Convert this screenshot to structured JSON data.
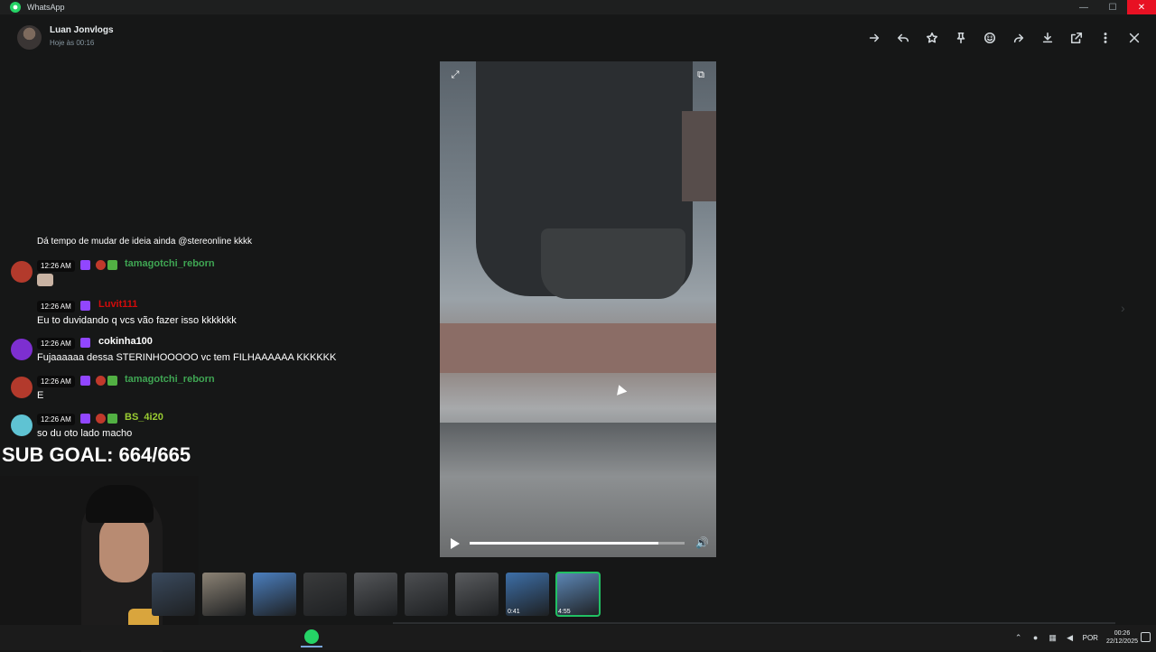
{
  "app": {
    "title": "WhatsApp",
    "icon": "whatsapp-logo-icon"
  },
  "window_controls": [
    {
      "name": "minimize",
      "glyph": "—"
    },
    {
      "name": "maximize",
      "glyph": "☐"
    },
    {
      "name": "close",
      "glyph": "✕"
    }
  ],
  "viewer": {
    "sender_name": "Luan Jonvlogs",
    "sender_time": "Hoje às 00:16",
    "toolbar": [
      "forward-icon",
      "reply-icon",
      "star-icon",
      "pin-icon",
      "emoji-icon",
      "share-icon",
      "download-icon",
      "open-external-icon",
      "more-icon",
      "close-icon"
    ],
    "video": {
      "progress": 0.88
    }
  },
  "chat": {
    "cut_text": "Dá tempo de mudar de ideia ainda @stereonline kkkk",
    "messages": [
      {
        "time": "12:26 AM",
        "user": "tamagotchi_reborn",
        "user_color": "#3fa653",
        "text": "",
        "emote": true,
        "avatar_color": "#b33a2c"
      },
      {
        "time": "12:26 AM",
        "user": "Luvit111",
        "user_color": "#d10b0b",
        "text": "Eu to duvidando q vcs vão fazer isso kkkkkkk",
        "emote": false,
        "avatar_color": ""
      },
      {
        "time": "12:26 AM",
        "user": "cokinha100",
        "user_color": "#ffffff",
        "text": "Fujaaaaaa dessa STERINHOOOOO vc tem FILHAAAAAA KKKKKK",
        "emote": false,
        "avatar_color": "#7d2fd0"
      },
      {
        "time": "12:26 AM",
        "user": "tamagotchi_reborn",
        "user_color": "#3fa653",
        "text": "E",
        "emote": false,
        "avatar_color": "#b33a2c"
      },
      {
        "time": "12:26 AM",
        "user": "BS_4i20",
        "user_color": "#9acd32",
        "text": "so du oto lado macho",
        "emote": false,
        "avatar_color": "#5fc3d3"
      }
    ]
  },
  "overlay": {
    "sub_goal": "SUB GOAL: 664/665"
  },
  "thumbnails": [
    {
      "label": "",
      "color": "#3a4a5e"
    },
    {
      "label": "",
      "color": "#8c8375"
    },
    {
      "label": "",
      "color": "#4b7fbf"
    },
    {
      "label": "",
      "color": "#3a3b3c"
    },
    {
      "label": "",
      "color": "#55575a"
    },
    {
      "label": "",
      "color": "#4d4f52"
    },
    {
      "label": "",
      "color": "#5a5c5f"
    },
    {
      "label": "0:41",
      "color": "#3d6fa8"
    },
    {
      "label": "4:55",
      "color": "#5d88b8"
    }
  ],
  "taskbar": {
    "lang": "POR",
    "time": "00:26",
    "date": "22/12/2025"
  }
}
